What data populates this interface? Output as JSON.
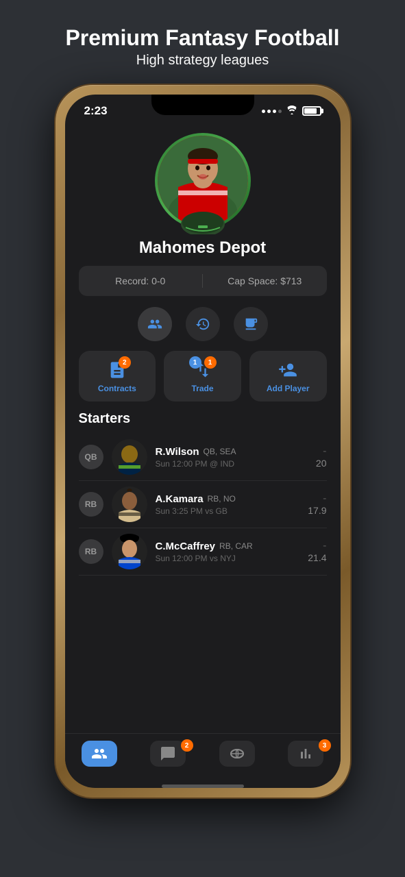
{
  "header": {
    "title": "Premium Fantasy Football",
    "subtitle": "High strategy leagues"
  },
  "status_bar": {
    "time": "2:23",
    "battery_pct": 85
  },
  "team": {
    "name": "Mahomes Depot",
    "record_label": "Record: 0-0",
    "cap_space_label": "Cap Space: $713"
  },
  "action_buttons": {
    "contracts": {
      "label": "Contracts",
      "badge": "2",
      "badge_color": "orange"
    },
    "trade": {
      "label": "Trade",
      "badge_left": "1",
      "badge_right": "1",
      "badge_color": "blue"
    },
    "add_player": {
      "label": "Add Player"
    }
  },
  "starters": {
    "title": "Starters",
    "players": [
      {
        "position": "QB",
        "name": "R.Wilson",
        "pos_team": "QB, SEA",
        "game": "Sun 12:00 PM @ IND",
        "score_dash": "-",
        "score": "20"
      },
      {
        "position": "RB",
        "name": "A.Kamara",
        "pos_team": "RB, NO",
        "game": "Sun 3:25 PM vs GB",
        "score_dash": "-",
        "score": "17.9"
      },
      {
        "position": "RB",
        "name": "C.McCaffrey",
        "pos_team": "RB, CAR",
        "game": "Sun 12:00 PM vs NYJ",
        "score_dash": "-",
        "score": "21.4"
      }
    ]
  },
  "tab_bar": {
    "tabs": [
      {
        "id": "roster",
        "label": "",
        "active": true,
        "badge": null
      },
      {
        "id": "chat",
        "label": "",
        "active": false,
        "badge": "2"
      },
      {
        "id": "ball",
        "label": "",
        "active": false,
        "badge": null
      },
      {
        "id": "stats",
        "label": "",
        "active": false,
        "badge": "3"
      }
    ]
  },
  "colors": {
    "accent_blue": "#4a90e2",
    "badge_orange": "#ff6b00",
    "bg_dark": "#1c1c1e",
    "bg_card": "#2c2c2e",
    "text_primary": "#ffffff",
    "text_secondary": "#aaaaaa"
  }
}
